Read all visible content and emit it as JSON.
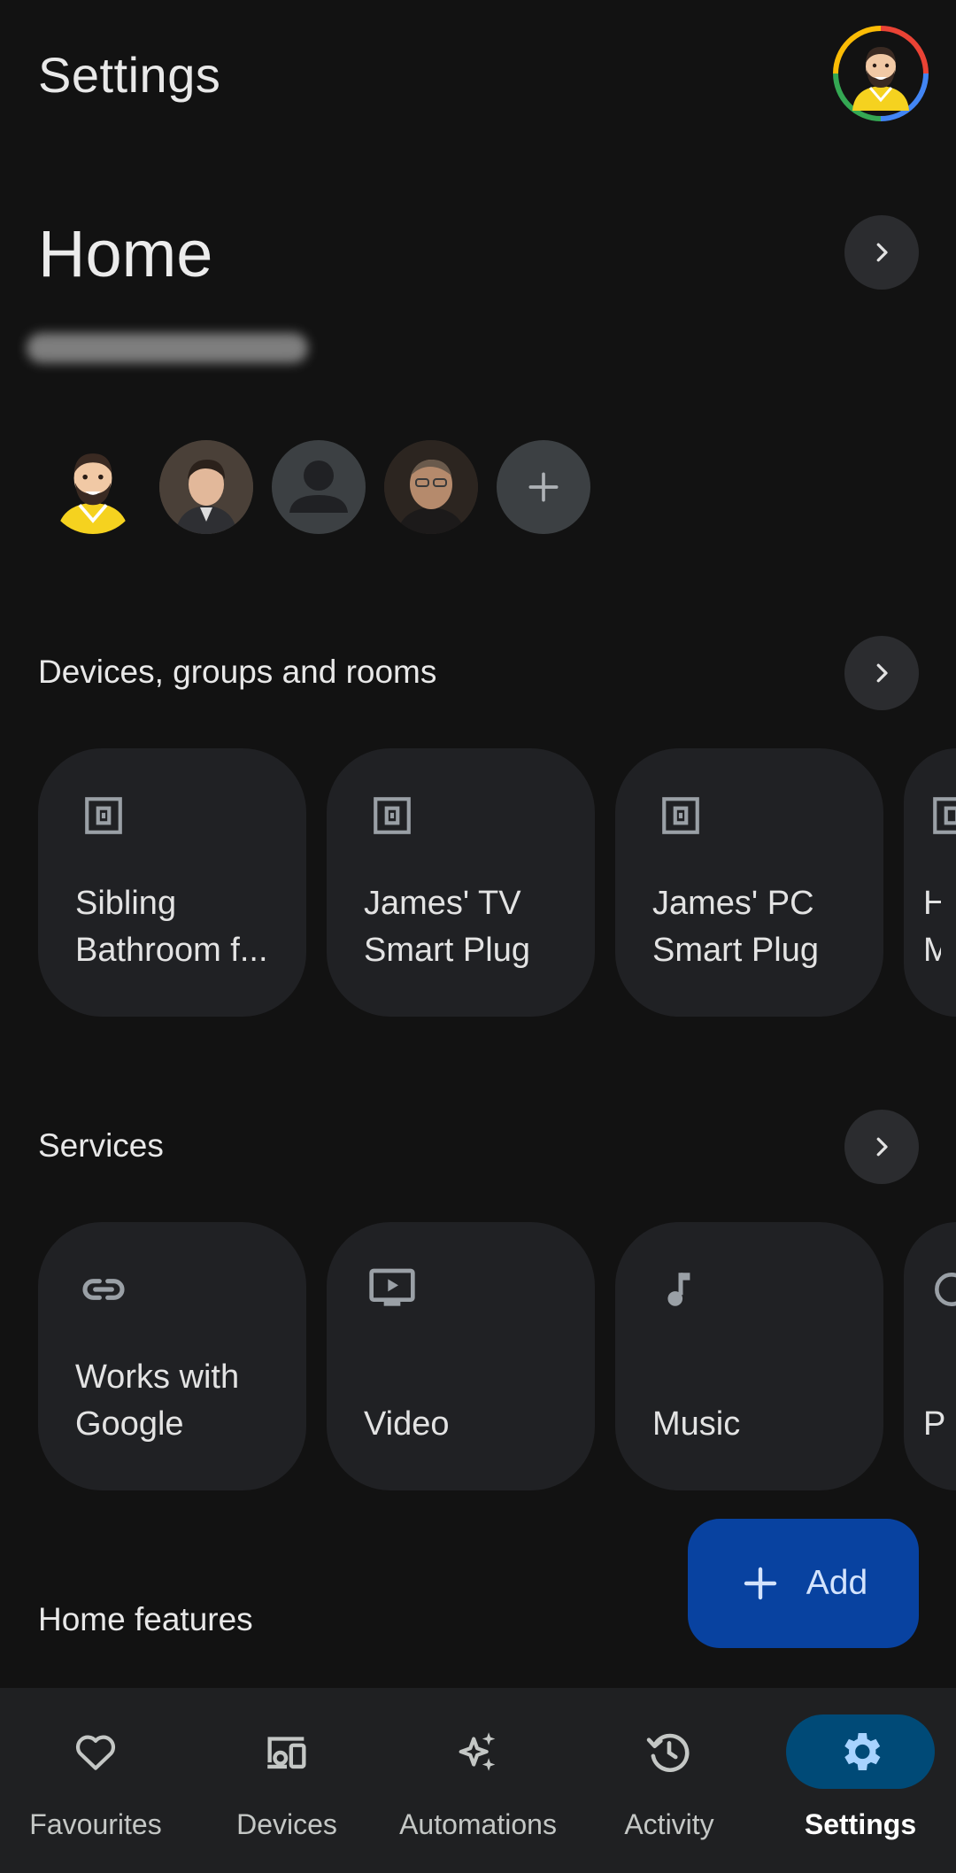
{
  "header": {
    "title": "Settings"
  },
  "home": {
    "title": "Home"
  },
  "sections": {
    "devices": {
      "title": "Devices, groups and rooms",
      "cards": [
        {
          "label": "Sibling Bathroom f...",
          "icon": "smart-plug-icon"
        },
        {
          "label": "James' TV Smart Plug",
          "icon": "smart-plug-icon"
        },
        {
          "label": "James' PC Smart Plug",
          "icon": "smart-plug-icon"
        },
        {
          "label": "H M",
          "icon": "smart-plug-icon"
        }
      ]
    },
    "services": {
      "title": "Services",
      "cards": [
        {
          "label": "Works with Google",
          "icon": "link-icon"
        },
        {
          "label": "Video",
          "icon": "video-icon"
        },
        {
          "label": "Music",
          "icon": "music-note-icon"
        },
        {
          "label": "P",
          "icon": "service-icon"
        }
      ]
    },
    "home_features": {
      "title": "Home features"
    }
  },
  "fab": {
    "label": "Add"
  },
  "nav": {
    "items": [
      {
        "label": "Favourites",
        "icon": "heart-icon"
      },
      {
        "label": "Devices",
        "icon": "devices-icon"
      },
      {
        "label": "Automations",
        "icon": "sparkle-icon"
      },
      {
        "label": "Activity",
        "icon": "history-icon"
      },
      {
        "label": "Settings",
        "icon": "gear-icon",
        "active": true
      }
    ]
  },
  "colors": {
    "background": "#121212",
    "card": "#202124",
    "fab": "#0842a0",
    "nav_active": "#004a77",
    "nav_bar": "#1f2022"
  }
}
